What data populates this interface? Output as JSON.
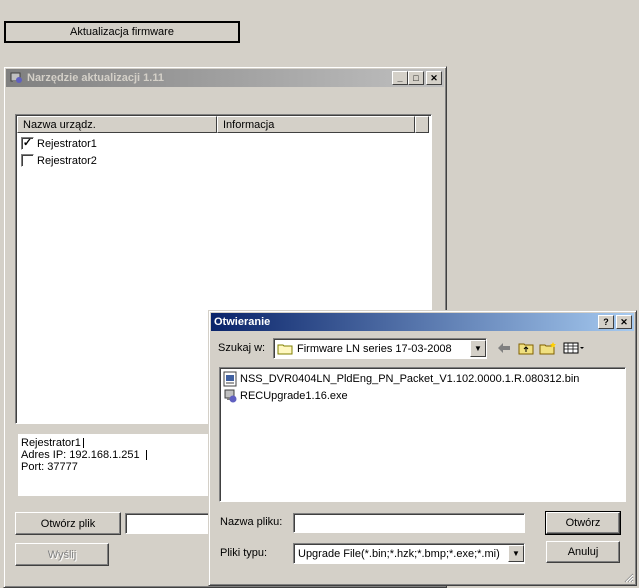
{
  "top_button": {
    "label": "Aktualizacja firmware"
  },
  "updater": {
    "title": "Narzędzie aktualizacji 1.11",
    "columns": [
      "Nazwa urządz.",
      "Informacja"
    ],
    "devices": [
      {
        "name": "Rejestrator1",
        "checked": true
      },
      {
        "name": "Rejestrator2",
        "checked": false
      }
    ],
    "info": {
      "line1": "Rejestrator1",
      "line2": "Adres IP: 192.168.1.251",
      "line3": "Port: 37777"
    },
    "open_file_label": "Otwórz plik",
    "send_label": "Wyślij"
  },
  "open_dialog": {
    "title": "Otwieranie",
    "look_in_label": "Szukaj w:",
    "look_in_value": "Firmware LN series 17-03-2008",
    "files": [
      {
        "name": "NSS_DVR0404LN_PldEng_PN_Packet_V1.102.0000.1.R.080312.bin",
        "icon": "bin-file-icon"
      },
      {
        "name": "RECUpgrade1.16.exe",
        "icon": "exe-file-icon"
      }
    ],
    "filename_label": "Nazwa pliku:",
    "filename_value": "",
    "filetype_label": "Pliki typu:",
    "filetype_value": "Upgrade File(*.bin;*.hzk;*.bmp;*.exe;*.mi)",
    "open_label": "Otwórz",
    "cancel_label": "Anuluj"
  }
}
